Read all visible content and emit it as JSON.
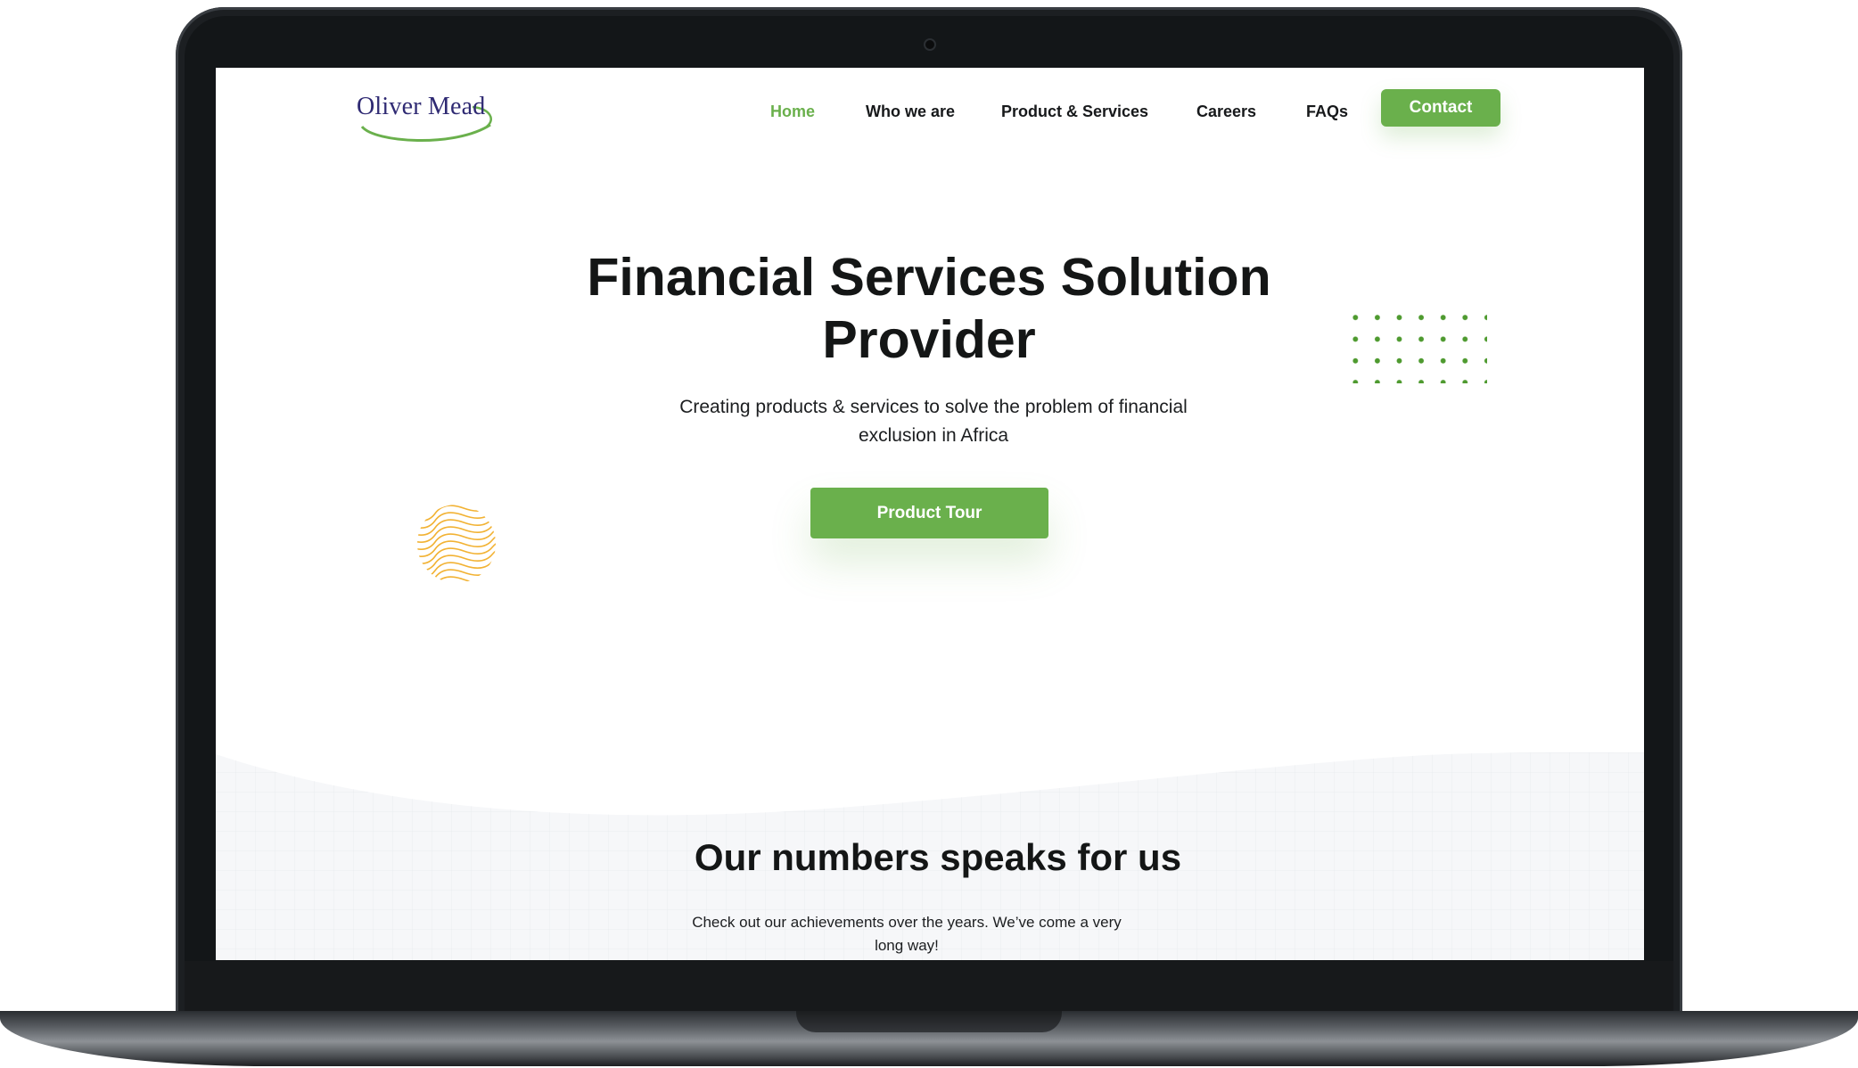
{
  "brand": {
    "name": "Oliver Mead",
    "accent_color": "#6ab04c",
    "logo_text_color": "#2f2a73",
    "decor_orange": "#f2b233"
  },
  "nav": {
    "items": [
      {
        "label": "Home",
        "active": true
      },
      {
        "label": "Who we are",
        "active": false
      },
      {
        "label": "Product & Services",
        "active": false
      },
      {
        "label": "Careers",
        "active": false
      },
      {
        "label": "FAQs",
        "active": false
      }
    ],
    "contact_label": "Contact"
  },
  "hero": {
    "title_line1": "Financial Services Solution",
    "title_line2": "Provider",
    "subtitle_line1": "Creating products & services to solve the problem of financial",
    "subtitle_line2": "exclusion in Africa",
    "cta_label": "Product Tour"
  },
  "numbers": {
    "title": "Our numbers speaks for us",
    "subtitle_line1": "Check out our achievements over the years. We’ve come a very",
    "subtitle_line2": "long way!"
  },
  "icons": {
    "dot_grid": "dot-grid-icon",
    "squiggle_circle": "squiggle-circle-icon",
    "camera": "camera-icon"
  }
}
